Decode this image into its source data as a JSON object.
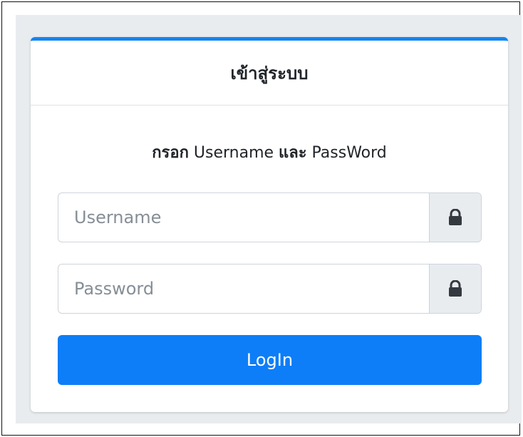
{
  "card": {
    "title": "เข้าสู่ระบบ",
    "subtitle_bold": "กรอก",
    "subtitle_text_1": " Username ",
    "subtitle_bold_2": "และ",
    "subtitle_text_2": " PassWord"
  },
  "fields": {
    "username": {
      "placeholder": "Username",
      "value": "",
      "icon": "lock-icon"
    },
    "password": {
      "placeholder": "Password",
      "value": "",
      "icon": "lock-icon"
    }
  },
  "login_button": {
    "label": "LogIn"
  },
  "colors": {
    "accent": "#0d7ef7",
    "card_top_border": "#1385f1",
    "panel_bg": "#e9ecef",
    "addon_bg": "#e9ecef"
  }
}
